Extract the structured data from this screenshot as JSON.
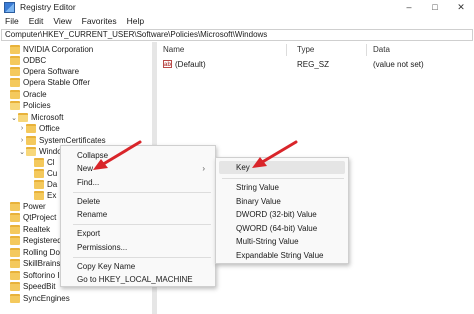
{
  "window": {
    "title": "Registry Editor"
  },
  "menubar": {
    "items": [
      "File",
      "Edit",
      "View",
      "Favorites",
      "Help"
    ]
  },
  "address": {
    "path": "Computer\\HKEY_CURRENT_USER\\Software\\Policies\\Microsoft\\Windows"
  },
  "tree": {
    "items": [
      {
        "label": "NVIDIA Corporation"
      },
      {
        "label": "ODBC"
      },
      {
        "label": "Opera Software"
      },
      {
        "label": "Opera Stable Offer"
      },
      {
        "label": "Oracle"
      },
      {
        "label": "Policies"
      },
      {
        "label": "Microsoft"
      },
      {
        "label": "Office"
      },
      {
        "label": "SystemCertificates"
      },
      {
        "label": "Windo"
      },
      {
        "label": "Cl"
      },
      {
        "label": "Cu"
      },
      {
        "label": "Da"
      },
      {
        "label": "Ex"
      },
      {
        "label": "Power"
      },
      {
        "label": "QtProject"
      },
      {
        "label": "Realtek"
      },
      {
        "label": "RegisteredA"
      },
      {
        "label": "Rolling Do"
      },
      {
        "label": "SkillBrains"
      },
      {
        "label": "Softorino In"
      },
      {
        "label": "SpeedBit"
      },
      {
        "label": "SyncEngines"
      }
    ]
  },
  "list": {
    "columns": [
      "Name",
      "Type",
      "Data"
    ],
    "rows": [
      {
        "icon": "ab",
        "name": "(Default)",
        "type": "REG_SZ",
        "data": "(value not set)"
      }
    ]
  },
  "context_menu": {
    "items": [
      "Collapse",
      "New",
      "Find...",
      "Delete",
      "Rename",
      "Export",
      "Permissions...",
      "Copy Key Name",
      "Go to HKEY_LOCAL_MACHINE"
    ],
    "submenu_arrow": "›"
  },
  "new_submenu": {
    "items": [
      "Key",
      "String Value",
      "Binary Value",
      "DWORD (32-bit) Value",
      "QWORD (64-bit) Value",
      "Multi-String Value",
      "Expandable String Value"
    ],
    "highlighted": "Key"
  },
  "colors": {
    "arrow": "#d9252a",
    "folder": "#f4c95d",
    "highlight": "#e5e5e5"
  }
}
